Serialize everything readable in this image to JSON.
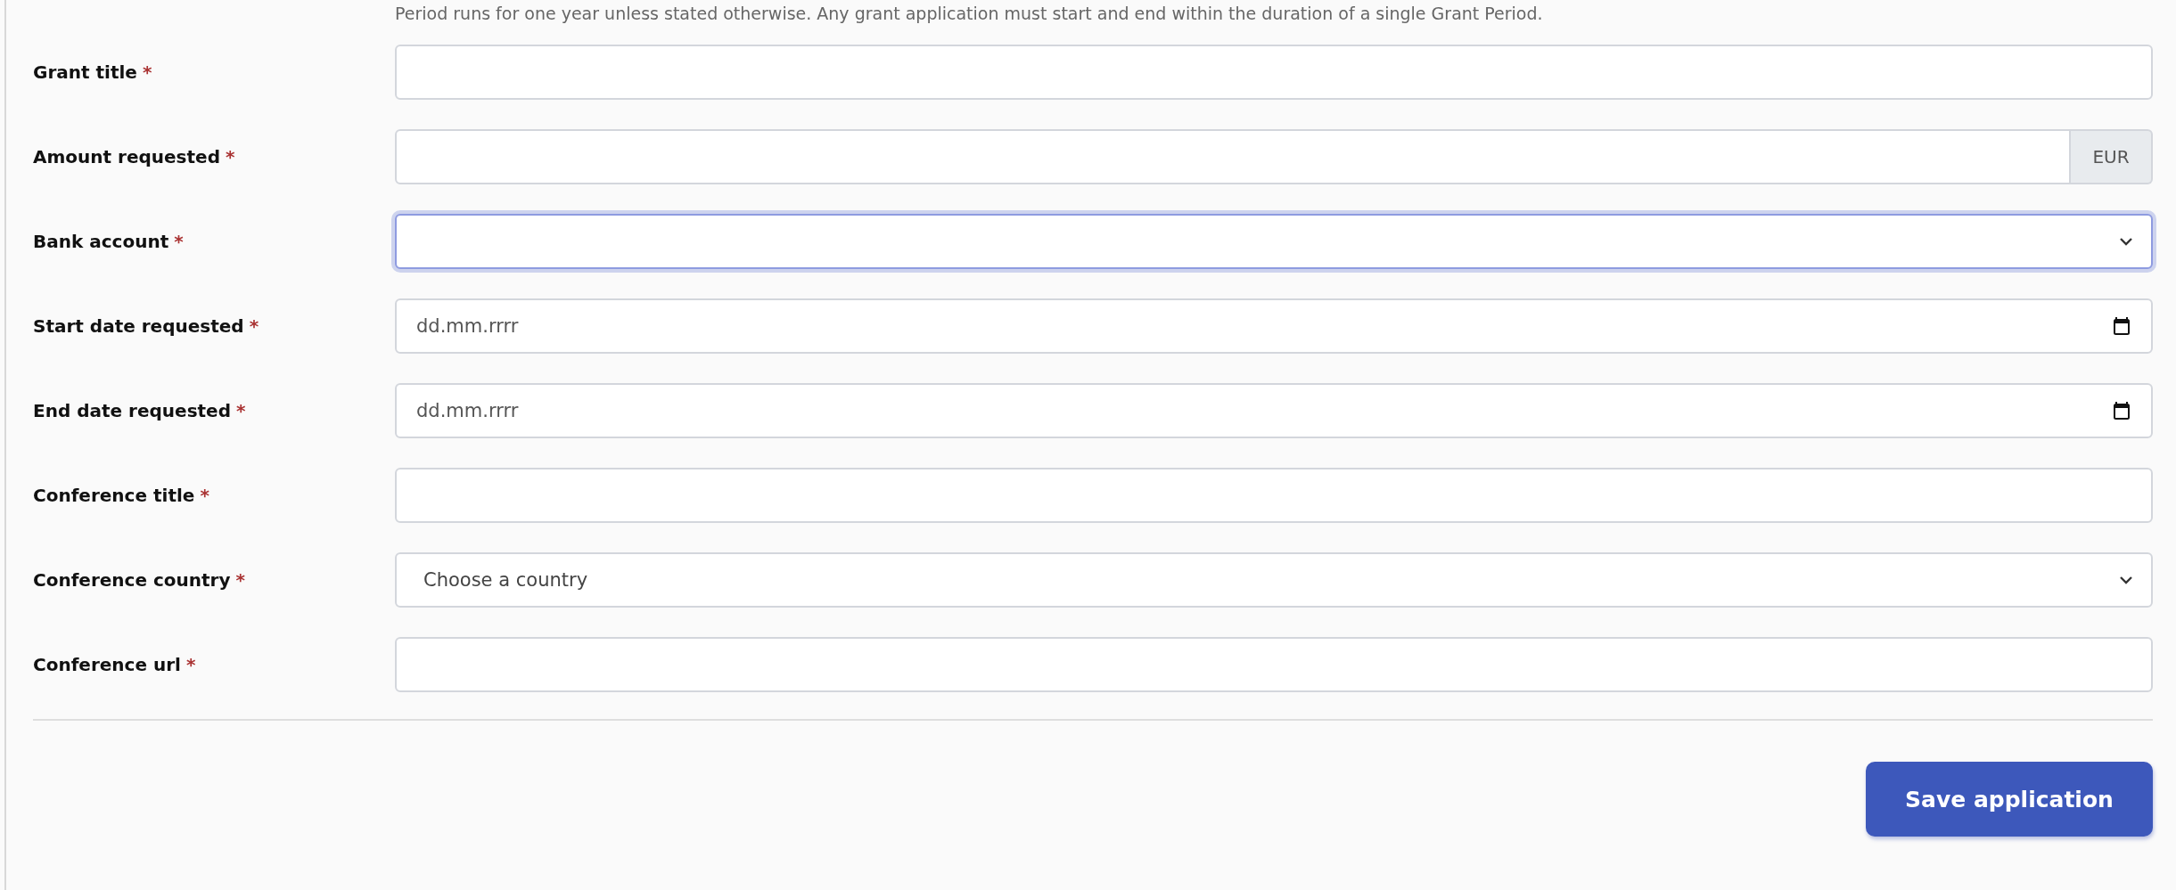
{
  "intro": "Period runs for one year unless stated otherwise. Any grant application must start and end within the duration of a single Grant Period.",
  "fields": [
    {
      "label": "Grant title",
      "required_mark": "*",
      "kind": "text",
      "focused": false
    },
    {
      "label": "Amount requested",
      "required_mark": "*",
      "kind": "addon",
      "addon": "EUR",
      "focused": false
    },
    {
      "label": "Bank account",
      "required_mark": "*",
      "kind": "select",
      "focused": true
    },
    {
      "label": "Start date requested",
      "required_mark": "*",
      "kind": "date",
      "placeholder": "dd.mm.rrrr",
      "focused": false
    },
    {
      "label": "End date requested",
      "required_mark": "*",
      "kind": "date",
      "placeholder": "dd.mm.rrrr",
      "focused": false
    },
    {
      "label": "Conference title",
      "required_mark": "*",
      "kind": "text",
      "focused": false
    },
    {
      "label": "Conference country",
      "required_mark": "*",
      "kind": "select",
      "value": "Choose a country",
      "focused": false
    },
    {
      "label": "Conference url",
      "required_mark": "*",
      "kind": "text",
      "focused": false
    }
  ],
  "save_button": "Save application"
}
